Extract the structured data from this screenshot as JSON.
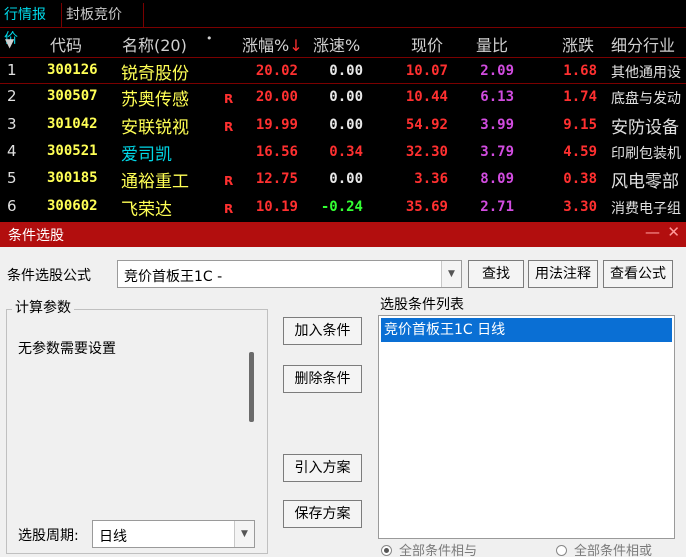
{
  "tabs": [
    {
      "label": "行情报价"
    },
    {
      "label": "封板竞价"
    }
  ],
  "table": {
    "headers": {
      "menu": "▼",
      "code": "代码",
      "name": "名称(20)",
      "dot": "•",
      "pct": "涨幅%",
      "pct_sort": "↓",
      "speed": "涨速%",
      "price": "现价",
      "vol_ratio": "量比",
      "change": "涨跌",
      "industry": "细分行业"
    },
    "rows": [
      {
        "idx": "1",
        "code": "300126",
        "name": "锐奇股份",
        "flag": "",
        "pct": "20.02",
        "speed": "0.00",
        "price": "10.07",
        "vol": "2.09",
        "chg": "1.68",
        "ind": "其他通用设"
      },
      {
        "idx": "2",
        "code": "300507",
        "name": "苏奥传感",
        "flag": "R",
        "pct": "20.00",
        "speed": "0.00",
        "price": "10.44",
        "vol": "6.13",
        "chg": "1.74",
        "ind": "底盘与发动"
      },
      {
        "idx": "3",
        "code": "301042",
        "name": "安联锐视",
        "flag": "R",
        "pct": "19.99",
        "speed": "0.00",
        "price": "54.92",
        "vol": "3.99",
        "chg": "9.15",
        "ind": "安防设备"
      },
      {
        "idx": "4",
        "code": "300521",
        "name": "爱司凯",
        "flag": "",
        "pct": "16.56",
        "speed": "0.34",
        "price": "32.30",
        "vol": "3.79",
        "chg": "4.59",
        "ind": "印刷包装机"
      },
      {
        "idx": "5",
        "code": "300185",
        "name": "通裕重工",
        "flag": "R",
        "pct": "12.75",
        "speed": "0.00",
        "price": "3.36",
        "vol": "8.09",
        "chg": "0.38",
        "ind": "风电零部"
      },
      {
        "idx": "6",
        "code": "300602",
        "name": "飞荣达",
        "flag": "R",
        "pct": "10.19",
        "speed": "-0.24",
        "price": "35.69",
        "vol": "2.71",
        "chg": "3.30",
        "ind": "消费电子组"
      }
    ]
  },
  "dialog": {
    "title": "条件选股",
    "min_glyph": "—",
    "close_glyph": "✕",
    "formula_label": "条件选股公式",
    "formula_value": "竞价首板王1C  -",
    "btn_find": "查找",
    "btn_usage": "用法注释",
    "btn_view": "查看公式",
    "param_group_title": "计算参数",
    "no_param_text": "无参数需要设置",
    "period_label": "选股周期:",
    "period_value": "日线",
    "btn_add": "加入条件",
    "btn_del": "删除条件",
    "btn_import": "引入方案",
    "btn_save": "保存方案",
    "list_title": "选股条件列表",
    "list_items": [
      "竞价首板王1C  日线"
    ],
    "radio_and": "全部条件相与",
    "radio_or": "全部条件相或"
  },
  "colors": {
    "name_yellow": "#ffff55",
    "up_red": "#ff3030",
    "down_green": "#33ff33",
    "neutral_white": "#e8e8e8",
    "vol_purple": "#d24ce0",
    "title_red": "#b20e0e",
    "select_blue": "#0a6fd4",
    "cyan_name": "#00d8e8"
  }
}
